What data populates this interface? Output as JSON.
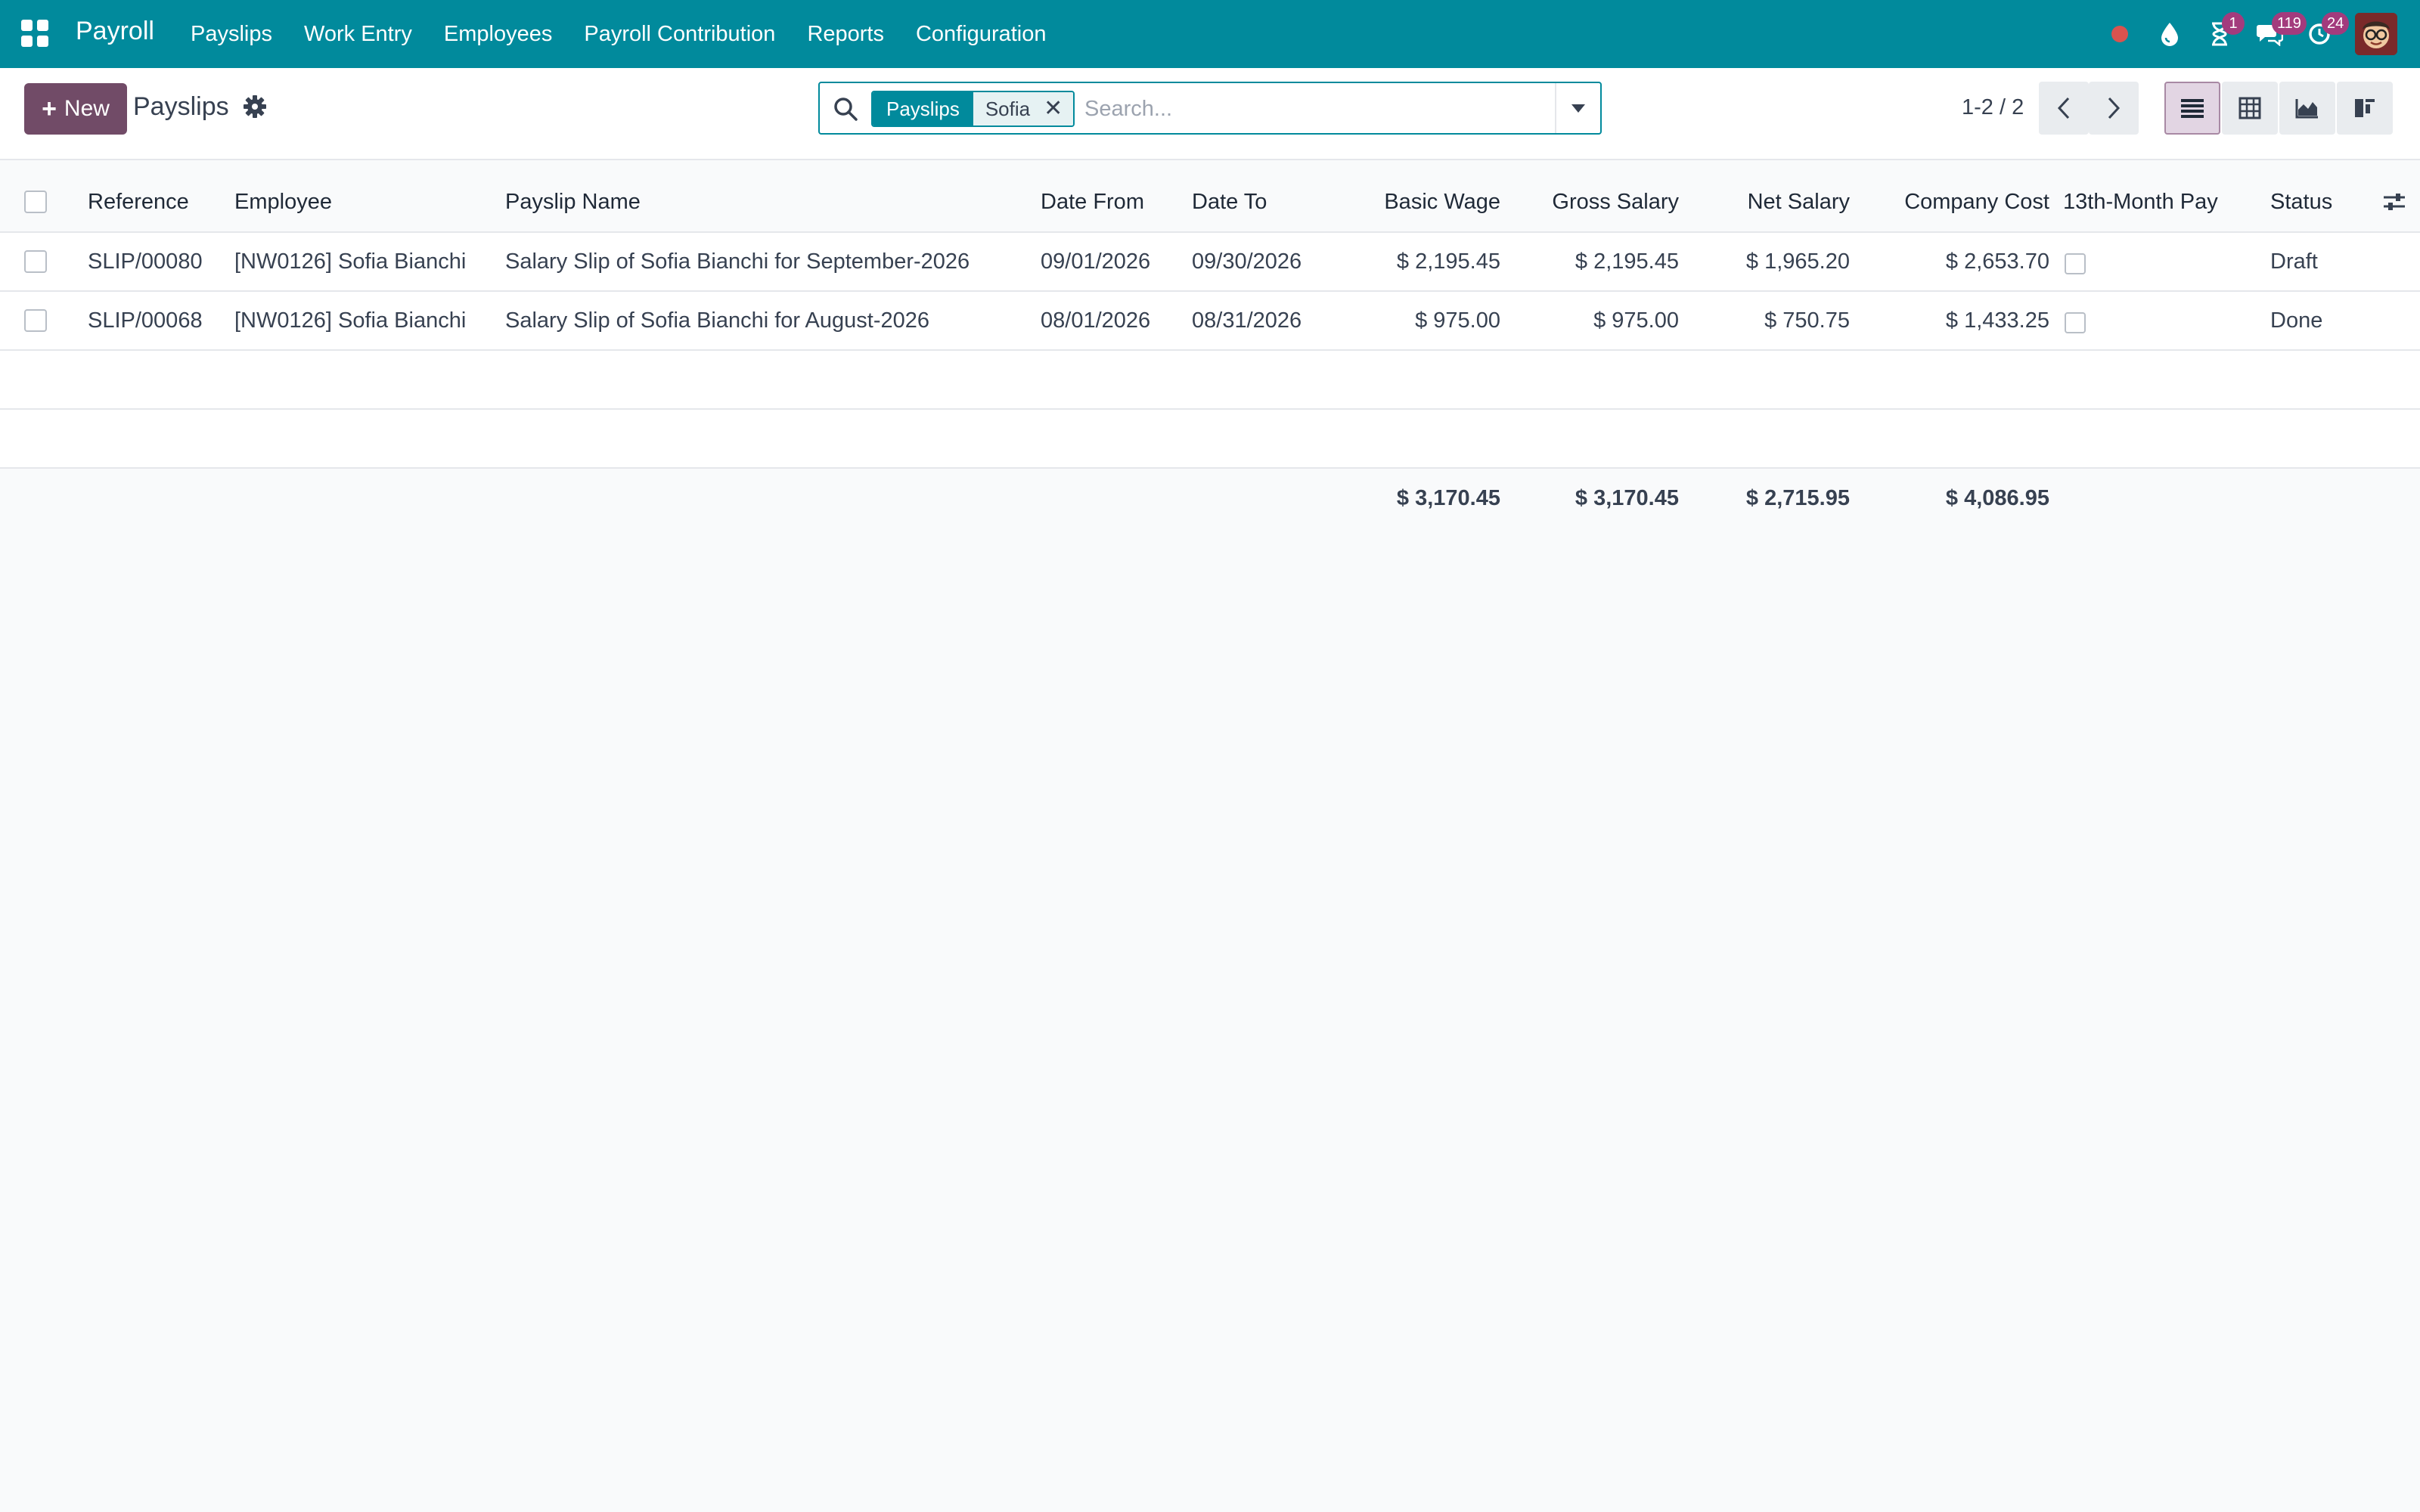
{
  "navbar": {
    "brand": "Payroll",
    "menu": [
      "Payslips",
      "Work Entry",
      "Employees",
      "Payroll Contribution",
      "Reports",
      "Configuration"
    ],
    "badges": {
      "activities": "1",
      "messages": "119",
      "updates": "24"
    },
    "color": "#018a9c"
  },
  "control_panel": {
    "new_label": "New",
    "title": "Payslips",
    "search": {
      "facet_label": "Payslips",
      "facet_value": "Sofia",
      "placeholder": "Search..."
    },
    "pager": "1-2 / 2"
  },
  "table": {
    "columns": {
      "reference": "Reference",
      "employee": "Employee",
      "payslip_name": "Payslip Name",
      "date_from": "Date From",
      "date_to": "Date To",
      "basic_wage": "Basic Wage",
      "gross_salary": "Gross Salary",
      "net_salary": "Net Salary",
      "company_cost": "Company Cost",
      "thirteenth": "13th-Month Pay",
      "status": "Status"
    },
    "rows": [
      {
        "reference": "SLIP/00080",
        "employee": "[NW0126] Sofia Bianchi",
        "payslip_name": "Salary Slip of Sofia Bianchi for September-2026",
        "date_from": "09/01/2026",
        "date_to": "09/30/2026",
        "basic_wage": "$ 2,195.45",
        "gross_salary": "$ 2,195.45",
        "net_salary": "$ 1,965.20",
        "company_cost": "$ 2,653.70",
        "thirteenth": false,
        "status": "Draft"
      },
      {
        "reference": "SLIP/00068",
        "employee": "[NW0126] Sofia Bianchi",
        "payslip_name": "Salary Slip of Sofia Bianchi for August-2026",
        "date_from": "08/01/2026",
        "date_to": "08/31/2026",
        "basic_wage": "$ 975.00",
        "gross_salary": "$ 975.00",
        "net_salary": "$ 750.75",
        "company_cost": "$ 1,433.25",
        "thirteenth": false,
        "status": "Done"
      }
    ],
    "totals": {
      "basic_wage": "$ 3,170.45",
      "gross_salary": "$ 3,170.45",
      "net_salary": "$ 2,715.95",
      "company_cost": "$ 4,086.95"
    }
  },
  "colors": {
    "primary": "#714b67",
    "accent": "#018a9c",
    "badge": "#a33b7d"
  }
}
